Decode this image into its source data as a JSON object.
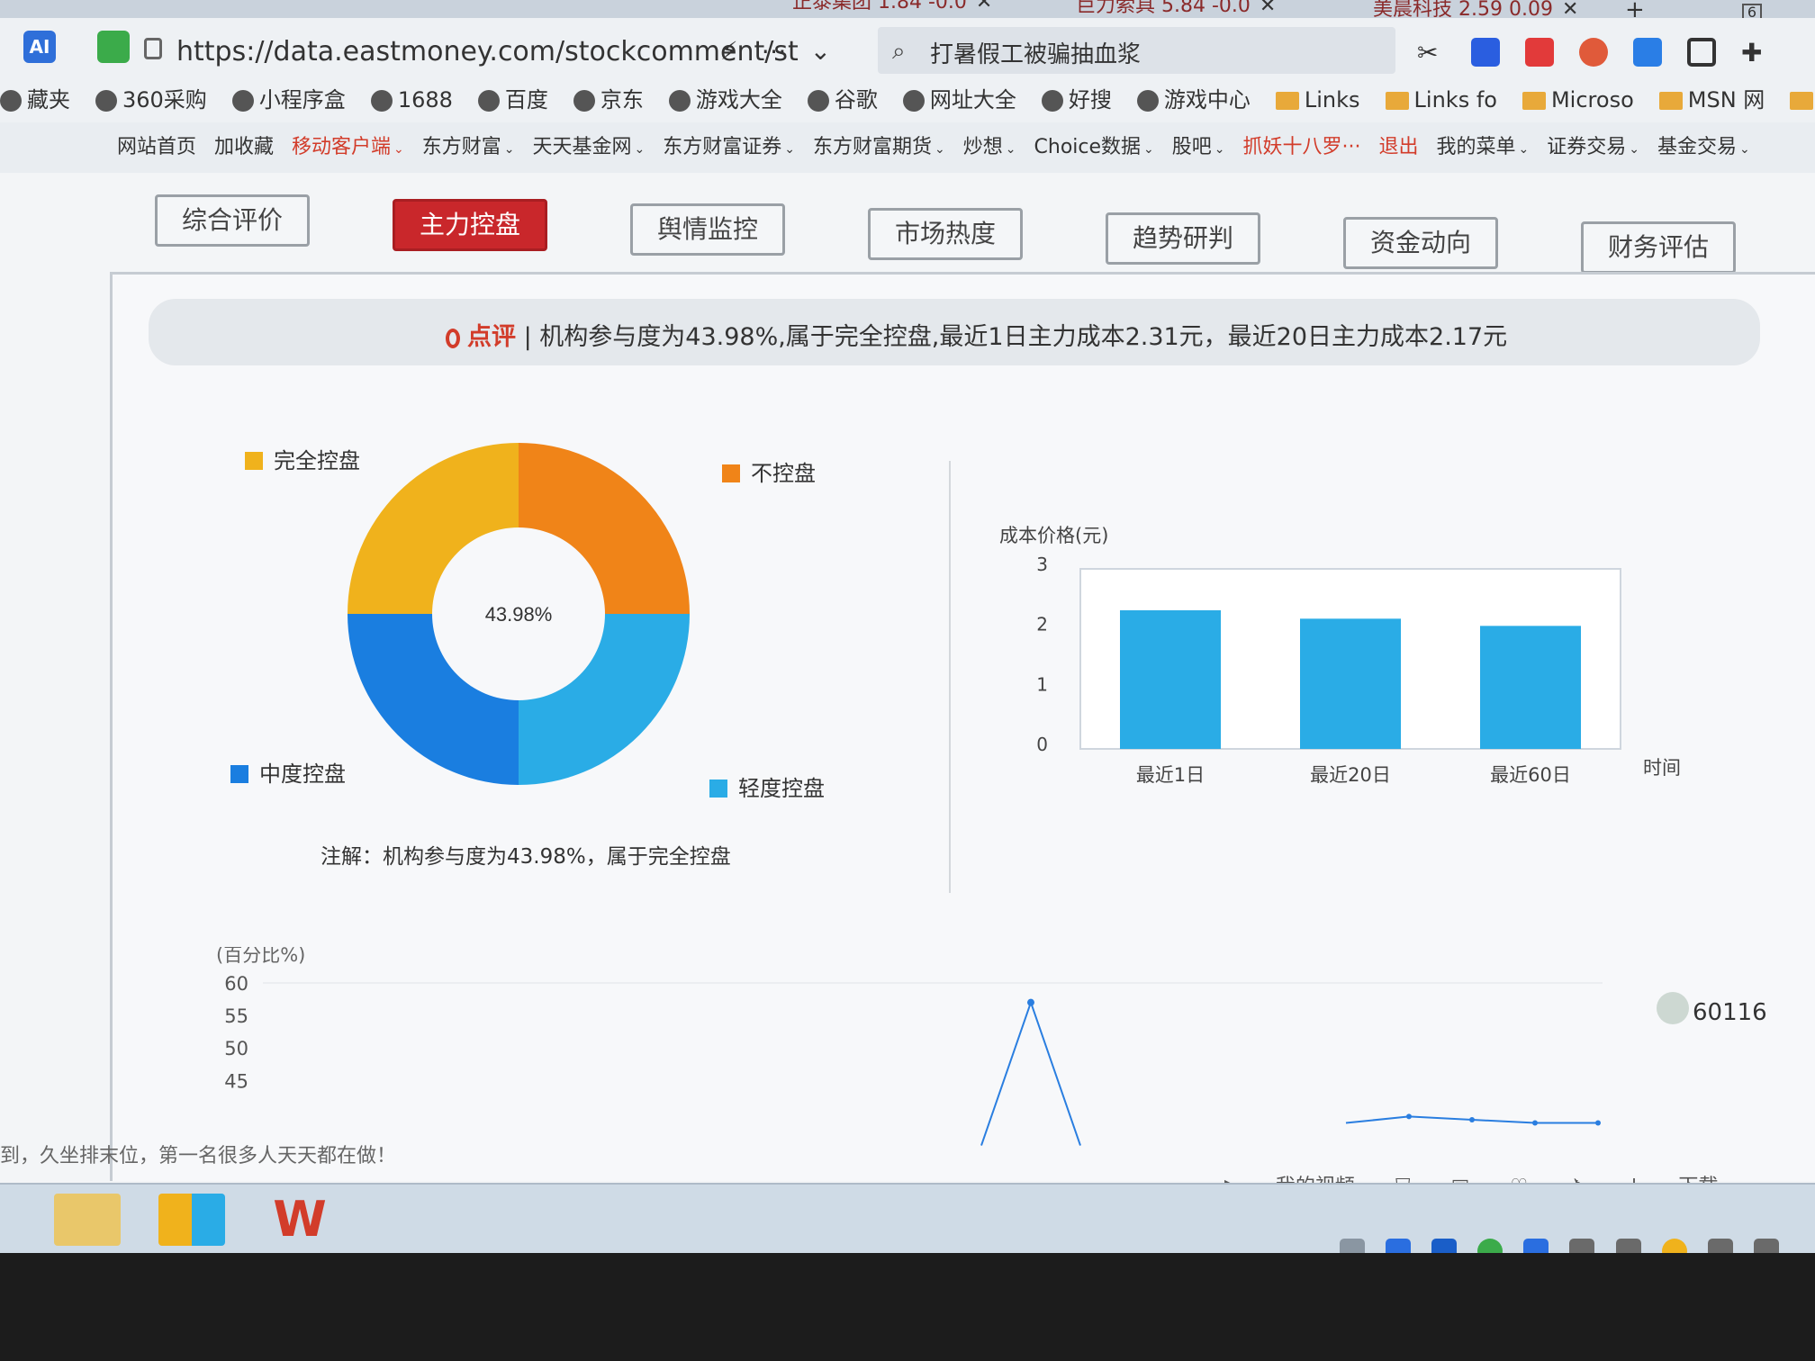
{
  "browser": {
    "tabs": [
      {
        "label": "正泰集团 1.84 -0.0"
      },
      {
        "label": "巨力索具 5.84 -0.0"
      },
      {
        "label": "美晨科技 2.59 0.09"
      }
    ],
    "url": "https://data.eastmoney.com/stockcomment/st",
    "search_text": "打暑假工被骗抽血浆",
    "tab_count": "6",
    "bookmarks": [
      "藏夹",
      "360采购",
      "小程序盒",
      "1688",
      "百度",
      "京东",
      "游戏大全",
      "谷歌",
      "网址大全",
      "好搜",
      "游戏中心",
      "Links",
      "Links fo",
      "Microso",
      "MSN 网",
      "Windo"
    ]
  },
  "site_nav": {
    "items": [
      {
        "label": "网站首页",
        "red": false,
        "caret": false
      },
      {
        "label": "加收藏",
        "red": false,
        "caret": false
      },
      {
        "label": "移动客户端",
        "red": true,
        "caret": true
      },
      {
        "label": "东方财富",
        "red": false,
        "caret": true
      },
      {
        "label": "天天基金网",
        "red": false,
        "caret": true
      },
      {
        "label": "东方财富证券",
        "red": false,
        "caret": true
      },
      {
        "label": "东方财富期货",
        "red": false,
        "caret": true
      },
      {
        "label": "炒想",
        "red": false,
        "caret": true
      },
      {
        "label": "Choice数据",
        "red": false,
        "caret": true
      },
      {
        "label": "股吧",
        "red": false,
        "caret": true
      },
      {
        "label": "抓妖十八罗···",
        "red": true,
        "caret": false
      },
      {
        "label": "退出",
        "red": true,
        "caret": false
      },
      {
        "label": "我的菜单",
        "red": false,
        "caret": true
      },
      {
        "label": "证券交易",
        "red": false,
        "caret": true
      },
      {
        "label": "基金交易",
        "red": false,
        "caret": true
      }
    ]
  },
  "tabs": [
    {
      "label": "综合评价",
      "active": false
    },
    {
      "label": "主力控盘",
      "active": true
    },
    {
      "label": "舆情监控",
      "active": false
    },
    {
      "label": "市场热度",
      "active": false
    },
    {
      "label": "趋势研判",
      "active": false
    },
    {
      "label": "资金动向",
      "active": false
    },
    {
      "label": "财务评估",
      "active": false
    }
  ],
  "comment": {
    "label": "点评",
    "text": "| 机构参与度为43.98%,属于完全控盘,最近1日主力成本2.31元，最近20日主力成本2.17元"
  },
  "donut": {
    "center_label": "43.98%",
    "note": "注解：机构参与度为43.98%，属于完全控盘",
    "legend": [
      {
        "label": "完全控盘",
        "color": "#f0b21c"
      },
      {
        "label": "不控盘",
        "color": "#f08418"
      },
      {
        "label": "中度控盘",
        "color": "#1a7ee0"
      },
      {
        "label": "轻度控盘",
        "color": "#2aace6"
      }
    ]
  },
  "chart_data": [
    {
      "type": "pie",
      "center_label": "43.98%",
      "categories": [
        "不控盘",
        "轻度控盘",
        "中度控盘",
        "完全控盘"
      ],
      "values": [
        25,
        25,
        25,
        25
      ],
      "colors": [
        "#f08418",
        "#2aace6",
        "#1a7ee0",
        "#f0b21c"
      ]
    },
    {
      "type": "bar",
      "categories": [
        "最近1日",
        "最近20日",
        "最近60日"
      ],
      "values": [
        2.31,
        2.17,
        2.05
      ],
      "ylabel": "成本价格(元)",
      "xlabel": "时间",
      "ylim": [
        0,
        3
      ],
      "yticks": [
        "3",
        "2",
        "1",
        "0"
      ],
      "color": "#2aace6",
      "grid": false
    },
    {
      "type": "line",
      "ylabel": "(百分比%)",
      "yticks": [
        "60",
        "55",
        "50",
        "45"
      ],
      "ylim": [
        42,
        60
      ],
      "series": [
        {
          "values": [
            35,
            57,
            35
          ]
        },
        {
          "values": [
            44,
            45,
            44.5,
            44,
            44
          ]
        }
      ]
    }
  ],
  "footer": {
    "scroll_text": "到，久坐排末位，第一名很多人天天都在做！",
    "ticker": "60116",
    "status_items": [
      "我的视频",
      "下载"
    ]
  }
}
